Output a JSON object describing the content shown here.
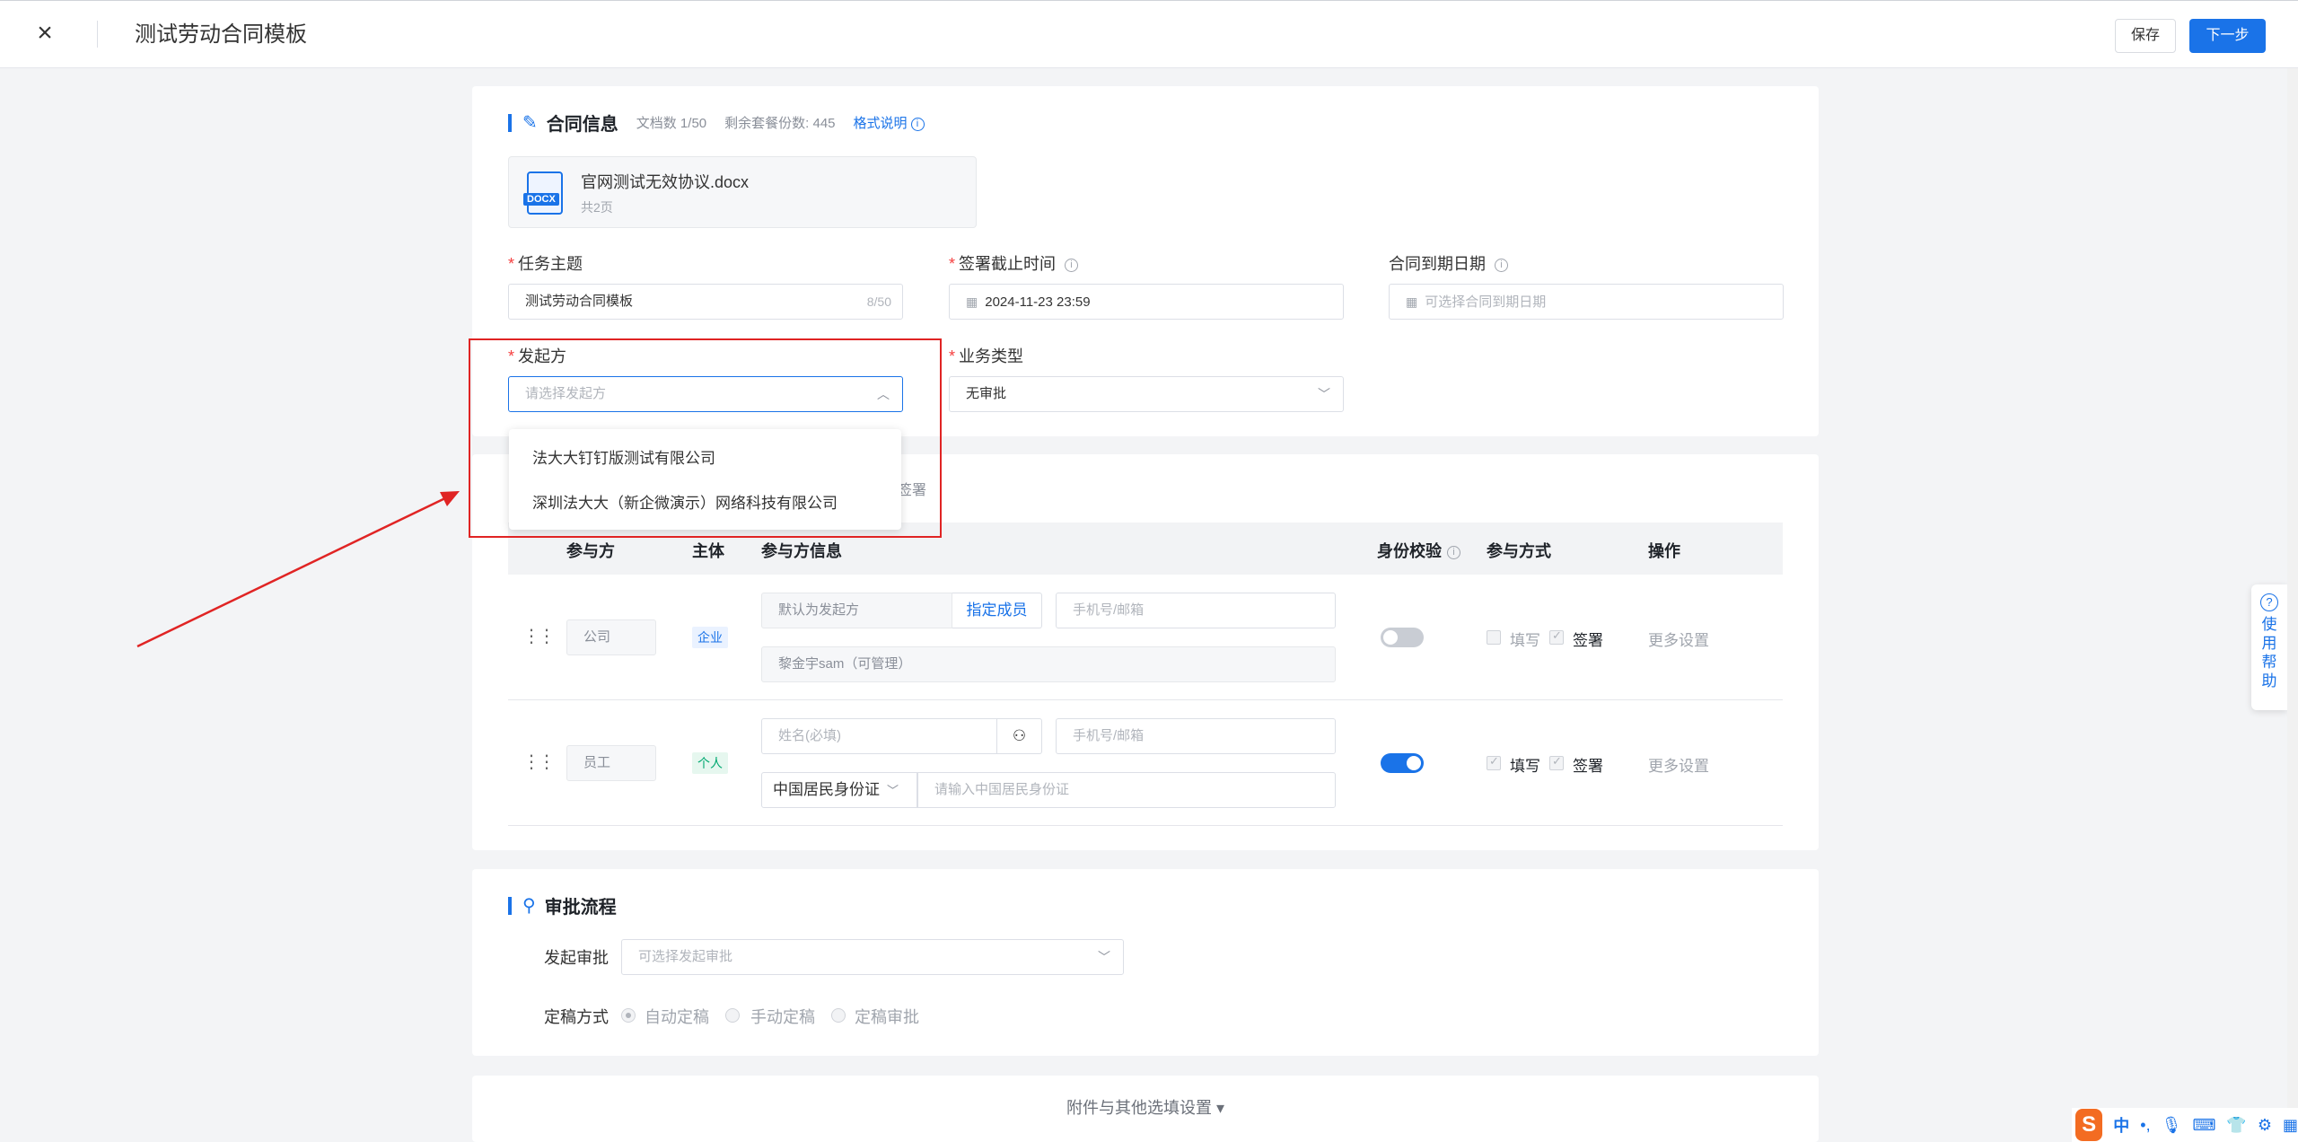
{
  "header": {
    "title": "测试劳动合同模板",
    "save_label": "保存",
    "next_label": "下一步"
  },
  "contract_info": {
    "title": "合同信息",
    "doc_count": "文档数 1/50",
    "remaining": "剩余套餐份数: 445",
    "format_link": "格式说明",
    "doc": {
      "icon_label": "DOCX",
      "name": "官网测试无效协议.docx",
      "pages": "共2页"
    },
    "subject": {
      "label": "任务主题",
      "value": "测试劳动合同模板",
      "counter": "8/50"
    },
    "deadline": {
      "label": "签署截止时间",
      "value": "2024-11-23 23:59"
    },
    "expiry": {
      "label": "合同到期日期",
      "placeholder": "可选择合同到期日期"
    },
    "initiator": {
      "label": "发起方",
      "placeholder": "请选择发起方"
    },
    "biz_type": {
      "label": "业务类型",
      "value": "无审批"
    },
    "initiator_options": [
      "法大大钉钉版测试有限公司",
      "深圳法大大（新企微演示）网络科技有限公司"
    ]
  },
  "participants": {
    "partial_text": "签署",
    "headers": [
      "参与方",
      "主体",
      "参与方信息",
      "身份校验",
      "参与方式",
      "操作"
    ],
    "rows": [
      {
        "role": "公司",
        "type": "企业",
        "info1": "默认为发起方",
        "assign_label": "指定成员",
        "phone_placeholder": "手机号/邮箱",
        "info2": "黎金宇sam（可管理）",
        "fill_label": "填写",
        "sign_label": "签署",
        "more": "更多设置"
      },
      {
        "role": "员工",
        "type": "个人",
        "name_placeholder": "姓名(必填)",
        "phone_placeholder": "手机号/邮箱",
        "id_type": "中国居民身份证",
        "id_placeholder": "请输入中国居民身份证",
        "fill_label": "填写",
        "sign_label": "签署",
        "more": "更多设置"
      }
    ]
  },
  "approval": {
    "title": "审批流程",
    "initiate_label": "发起审批",
    "initiate_placeholder": "可选择发起审批",
    "finalize_label": "定稿方式",
    "options": [
      "自动定稿",
      "手动定稿",
      "定稿审批"
    ]
  },
  "attachments": {
    "label": "附件与其他选填设置 ▾"
  },
  "help": {
    "label": "使用帮助"
  },
  "ime": {
    "logo": "S",
    "lang": "中"
  },
  "colors": {
    "accent": "#1a73e8",
    "highlight_box": "#e02424",
    "required": "#f53f3f"
  }
}
